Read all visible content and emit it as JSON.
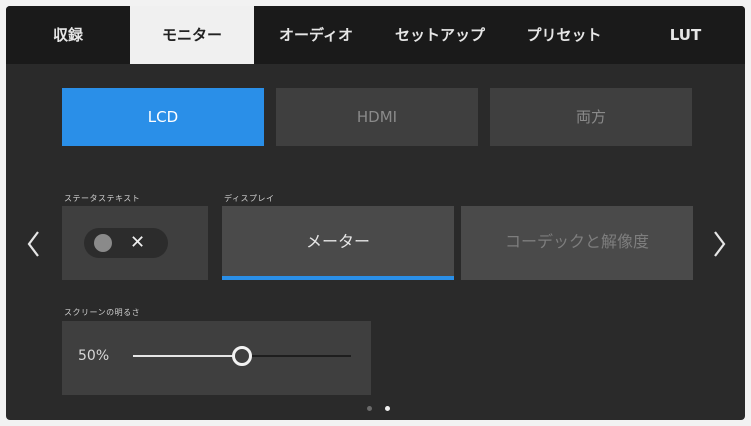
{
  "tabs": [
    {
      "label": "収録",
      "active": false
    },
    {
      "label": "モニター",
      "active": true
    },
    {
      "label": "オーディオ",
      "active": false
    },
    {
      "label": "セットアップ",
      "active": false
    },
    {
      "label": "プリセット",
      "active": false
    },
    {
      "label": "LUT",
      "active": false
    }
  ],
  "output": {
    "buttons": [
      {
        "label": "LCD",
        "active": true
      },
      {
        "label": "HDMI",
        "active": false
      },
      {
        "label": "両方",
        "active": false
      }
    ]
  },
  "status_text": {
    "label": "ステータステキスト",
    "toggle_value": "✕",
    "enabled": false
  },
  "display": {
    "label": "ディスプレイ",
    "options": [
      {
        "label": "メーター",
        "selected": true
      },
      {
        "label": "コーデックと解像度",
        "selected": false
      }
    ]
  },
  "brightness": {
    "label": "スクリーンの明るさ",
    "value_text": "50%",
    "value": 0.5
  },
  "pagination": {
    "pages": 2,
    "current": 2
  },
  "colors": {
    "accent": "#2a8fe8",
    "background": "#2a2a2a",
    "tab_bar": "#1a1a1a"
  },
  "icons": {
    "prev": "chevron-left-icon",
    "next": "chevron-right-icon"
  }
}
